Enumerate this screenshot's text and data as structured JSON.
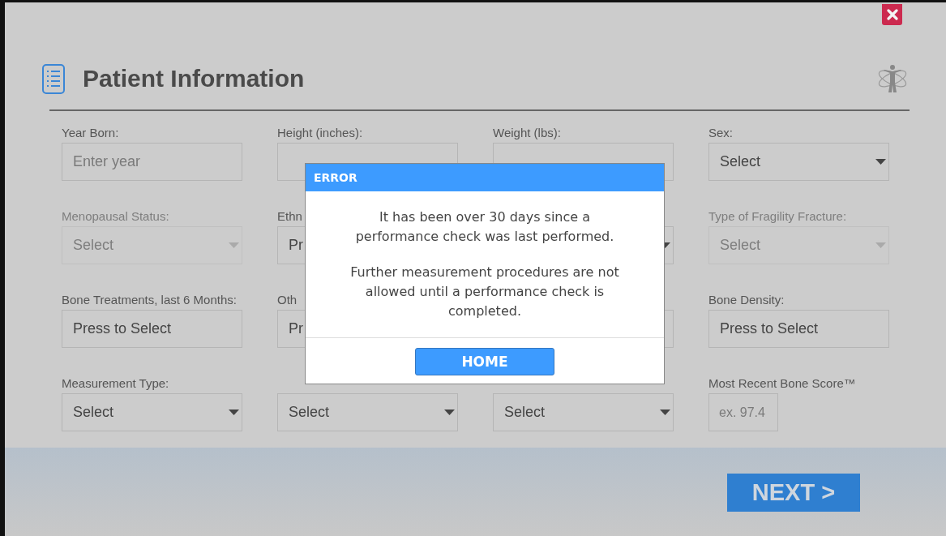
{
  "header": {
    "title": "Patient Information"
  },
  "fields": [
    {
      "label": "Year Born:",
      "kind": "text",
      "placeholder": "Enter year"
    },
    {
      "label": "Height (inches):",
      "kind": "text"
    },
    {
      "label": "Weight (lbs):",
      "kind": "text"
    },
    {
      "label": "Sex:",
      "kind": "select",
      "value": "Select",
      "disabled": false
    },
    {
      "label": "Menopausal Status:",
      "kind": "select",
      "value": "Select",
      "disabled": true
    },
    {
      "label": "Ethn",
      "kind": "picker",
      "value": "Pr"
    },
    {
      "kind": "select",
      "disabled": false
    },
    {
      "label": "Type of Fragility Fracture:",
      "kind": "select",
      "value": "Select",
      "disabled": true
    },
    {
      "label": "Bone Treatments, last 6 Months:",
      "kind": "picker",
      "value": "Press to Select"
    },
    {
      "label": "Oth",
      "kind": "picker",
      "value": "Pr"
    },
    {
      "kind": "picker"
    },
    {
      "label": "Bone Density:",
      "kind": "picker",
      "value": "Press to Select"
    },
    {
      "label": "Measurement Type:",
      "kind": "select",
      "value": "Select",
      "disabled": false
    },
    {
      "kind": "select",
      "value": "Select",
      "disabled": false
    },
    {
      "kind": "select",
      "value": "Select",
      "disabled": false
    },
    {
      "label": "Most Recent Bone Score™",
      "kind": "number",
      "placeholder": "ex. 97.4"
    }
  ],
  "footer": {
    "next_button": "NEXT >"
  },
  "dialog": {
    "title": "ERROR",
    "paragraphs": [
      "It has been over 30 days since a performance check was last performed.",
      "Further measurement procedures are not allowed until a performance check is completed."
    ],
    "button": "HOME"
  }
}
